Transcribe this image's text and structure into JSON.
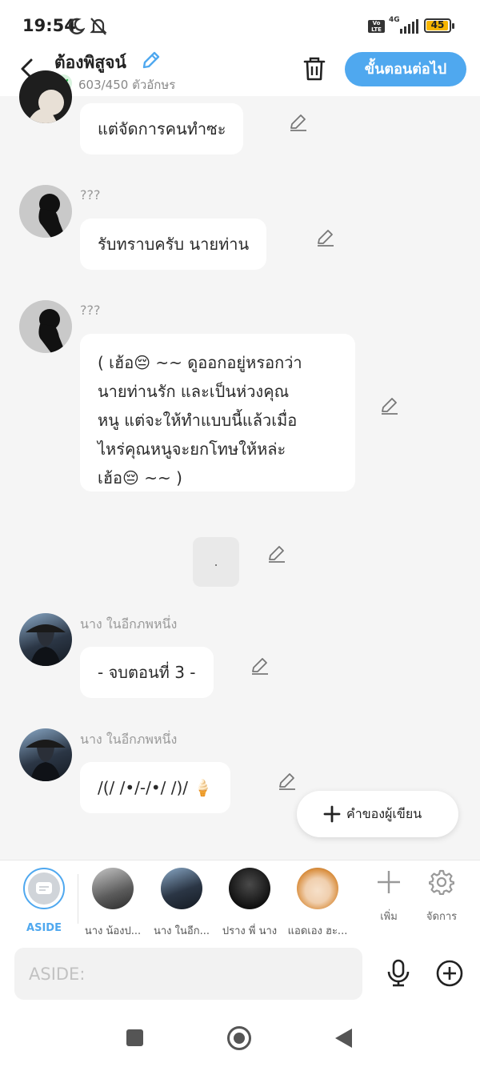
{
  "status_bar": {
    "time": "19:54",
    "network": "4G",
    "volte": "Vo LTE",
    "battery": "45"
  },
  "header": {
    "title": "ต้องพิสูจน์",
    "char_count": "603/450 ตัวอักษร",
    "next_label": "ขั้นตอนต่อไป"
  },
  "messages": [
    {
      "sender": "",
      "text": "แต่จัดการคนทำซะ"
    },
    {
      "sender": "???",
      "text": "รับทราบครับ นายท่าน"
    },
    {
      "sender": "???",
      "lines": [
        "( เฮ้อ😔 ~~ ดูออกอยู่หรอกว่า",
        "นายท่านรัก และเป็นห่วงคุณ",
        "หนู แต่จะให้ทำแบบนี้แล้วเมื่อ",
        "ไหร่คุณหนูจะยกโทษให้หล่ะ",
        "เฮ้อ😔 ~~ )"
      ]
    },
    {
      "sender": "",
      "text": "."
    },
    {
      "sender": "นาง ในอีกภพหนึ่ง",
      "text": "- จบตอนที่ 3 -"
    },
    {
      "sender": "นาง ในอีกภพหนึ่ง",
      "text": "/(/ /•/-/•/ /)/ 🍦"
    }
  ],
  "author_button": "คำของผู้เขียน",
  "characters": [
    {
      "label": "ASIDE"
    },
    {
      "label": "นาง น้องป..."
    },
    {
      "label": "นาง ในอีก..."
    },
    {
      "label": "ปราง พี่ นาง"
    },
    {
      "label": "แอดเอง ฮะ..."
    }
  ],
  "tools": {
    "add": "เพิ่ม",
    "manage": "จัดการ"
  },
  "input": {
    "placeholder": "ASIDE:"
  },
  "colors": {
    "accent": "#4fa8ef",
    "background": "#f5f5f5",
    "bubble": "#ffffff"
  }
}
